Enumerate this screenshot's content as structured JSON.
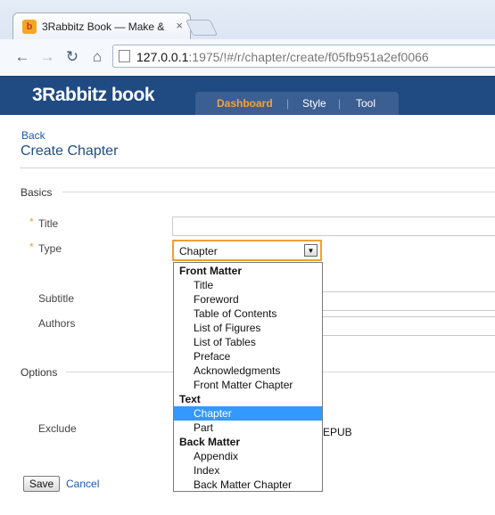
{
  "browser": {
    "tab_title": "3Rabbitz Book — Make &",
    "tab_close": "×",
    "url_host": "127.0.0.1",
    "url_path": ":1975/!#/r/chapter/create/f05fb951a2ef0066",
    "icons": [
      "back-icon",
      "forward-icon",
      "reload-icon",
      "home-icon"
    ]
  },
  "app": {
    "logo": "3Rabbitz book",
    "nav": [
      {
        "label": "Dashboard",
        "active": true
      },
      {
        "label": "Style",
        "active": false
      },
      {
        "label": "Tool",
        "active": false
      }
    ],
    "nav_separator": "|"
  },
  "page": {
    "back": "Back",
    "title": "Create Chapter"
  },
  "basics": {
    "label": "Basics",
    "title_label": "Title",
    "title_value": "",
    "type_label": "Type",
    "type_value": "Chapter",
    "subtitle_label": "Subtitle",
    "authors_label": "Authors",
    "required_mark": "*"
  },
  "type_dropdown": {
    "groups": [
      {
        "name": "Front Matter",
        "options": [
          "Title",
          "Foreword",
          "Table of Contents",
          "List of Figures",
          "List of Tables",
          "Preface",
          "Acknowledgments",
          "Front Matter Chapter"
        ]
      },
      {
        "name": "Text",
        "options": [
          "Chapter",
          "Part"
        ]
      },
      {
        "name": "Back Matter",
        "options": [
          "Appendix",
          "Index",
          "Back Matter Chapter"
        ]
      }
    ],
    "selected": "Chapter"
  },
  "options": {
    "label": "Options",
    "exclude_label": "Exclude",
    "exclude_value_partial": "EPUB"
  },
  "actions": {
    "save": "Save",
    "cancel": "Cancel"
  },
  "colors": {
    "appbar": "#1f4a82",
    "active_nav": "#f2a33a",
    "link": "#1a5ba8",
    "selected_option": "#3399ff",
    "focus_border": "#f0a030"
  }
}
